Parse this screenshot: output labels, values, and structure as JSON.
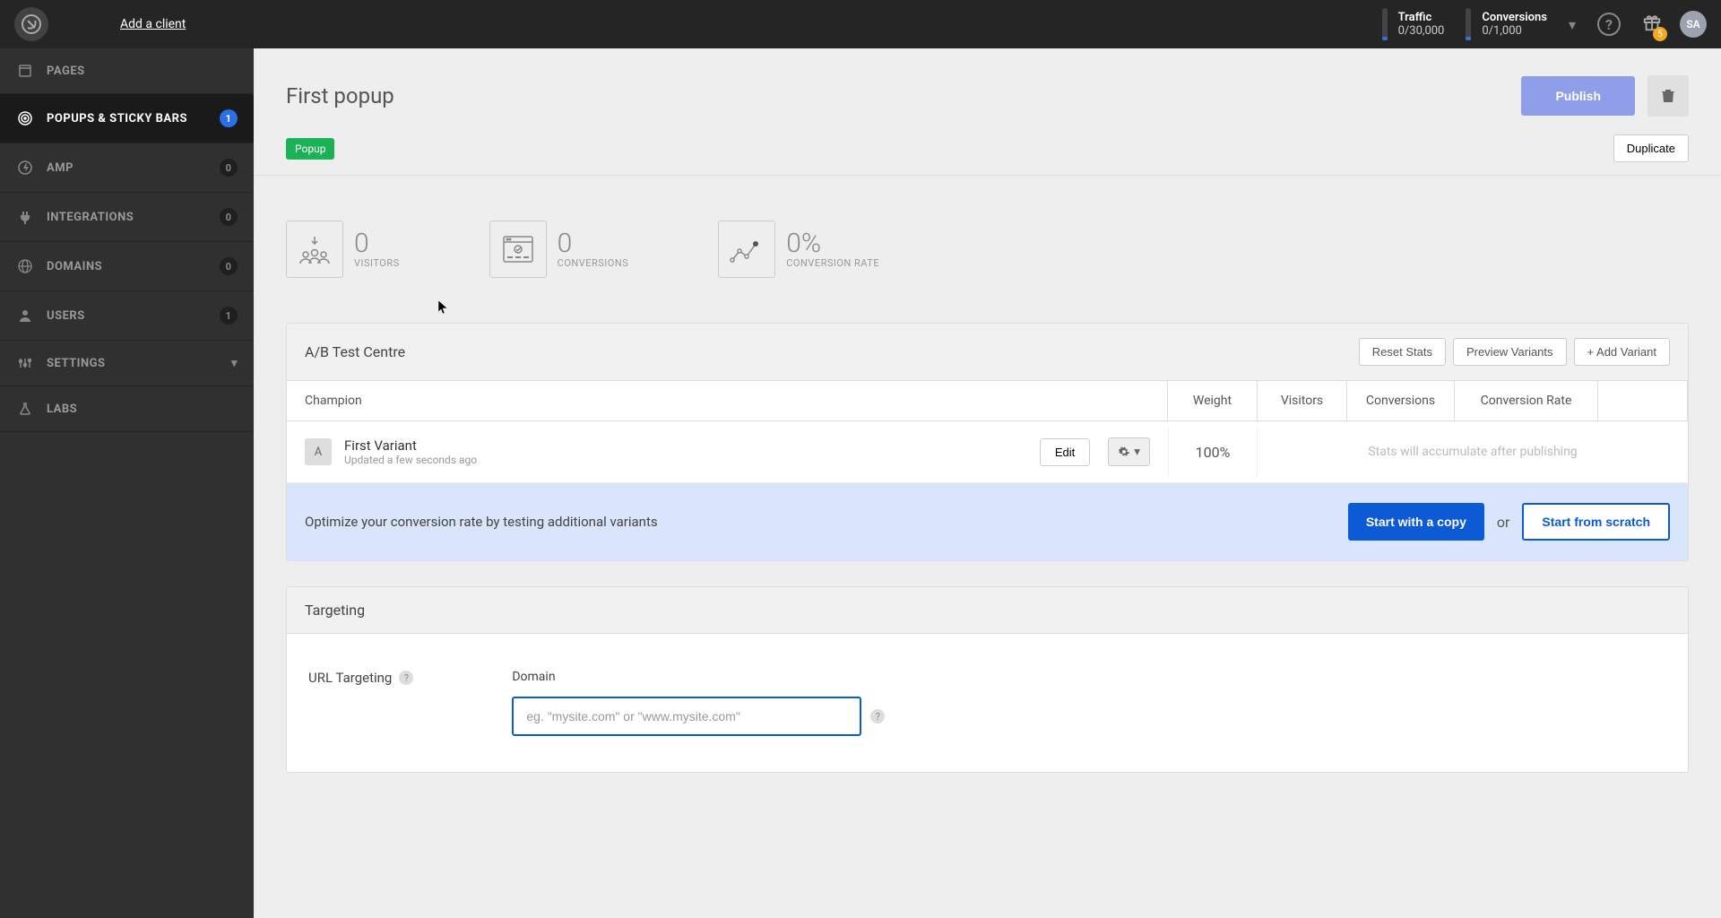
{
  "topbar": {
    "add_client": "Add a client",
    "traffic_label": "Traffic",
    "traffic_value": "0/30,000",
    "conversions_label": "Conversions",
    "conversions_value": "0/1,000",
    "gift_badge": "5",
    "avatar": "SA"
  },
  "sidebar": {
    "items": [
      {
        "icon": "page",
        "label": "PAGES",
        "badge": "",
        "active": false
      },
      {
        "icon": "target",
        "label": "POPUPS & STICKY BARS",
        "badge": "1",
        "active": true
      },
      {
        "icon": "bolt",
        "label": "AMP",
        "badge": "0",
        "active": false
      },
      {
        "icon": "plug",
        "label": "INTEGRATIONS",
        "badge": "0",
        "active": false
      },
      {
        "icon": "globe",
        "label": "DOMAINS",
        "badge": "0",
        "active": false
      },
      {
        "icon": "user",
        "label": "USERS",
        "badge": "1",
        "active": false
      },
      {
        "icon": "sliders",
        "label": "SETTINGS",
        "badge": "",
        "caret": true,
        "active": false
      },
      {
        "icon": "flask",
        "label": "LABS",
        "badge": "",
        "active": false
      }
    ]
  },
  "page": {
    "title": "First popup",
    "publish": "Publish",
    "tag": "Popup",
    "duplicate": "Duplicate"
  },
  "stats": {
    "visitors_num": "0",
    "visitors_label": "VISITORS",
    "conversions_num": "0",
    "conversions_label": "CONVERSIONS",
    "rate_num": "0%",
    "rate_label": "CONVERSION RATE"
  },
  "ab": {
    "title": "A/B Test Centre",
    "reset": "Reset Stats",
    "preview": "Preview Variants",
    "add_variant": "+ Add Variant",
    "col_champion": "Champion",
    "col_weight": "Weight",
    "col_visitors": "Visitors",
    "col_conversions": "Conversions",
    "col_rate": "Conversion Rate",
    "variant_letter": "A",
    "variant_name": "First Variant",
    "variant_meta": "Updated a few seconds ago",
    "edit": "Edit",
    "weight": "100%",
    "pending": "Stats will accumulate after publishing",
    "optimize_text": "Optimize your conversion rate by testing additional variants",
    "start_copy": "Start with a copy",
    "or": "or",
    "start_scratch": "Start from scratch"
  },
  "targeting": {
    "title": "Targeting",
    "url_label": "URL Targeting",
    "domain_label": "Domain",
    "domain_placeholder": "eg. \"mysite.com\" or \"www.mysite.com\""
  }
}
